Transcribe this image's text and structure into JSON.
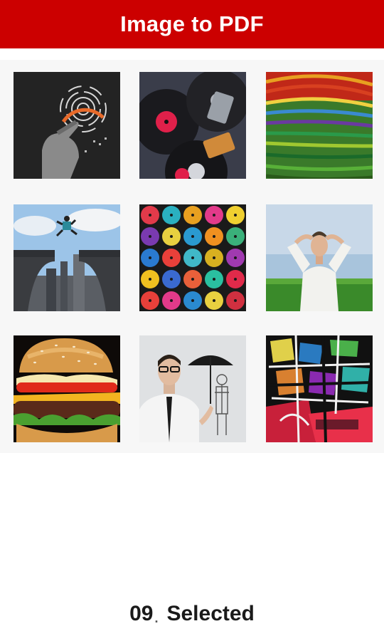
{
  "header": {
    "title": "Image to PDF"
  },
  "colors": {
    "header_bg": "#cc0000",
    "header_text": "#ffffff"
  },
  "grid": {
    "items": [
      {
        "name": "thumb-touch-interface"
      },
      {
        "name": "thumb-vinyl-records-cassettes"
      },
      {
        "name": "thumb-colorful-paint-strokes"
      },
      {
        "name": "thumb-man-jumping-bridge-gap"
      },
      {
        "name": "thumb-colorful-vinyl-discs"
      },
      {
        "name": "thumb-man-relaxing-field"
      },
      {
        "name": "thumb-hamburger"
      },
      {
        "name": "thumb-businessman-umbrella"
      },
      {
        "name": "thumb-abstract-graffiti"
      }
    ]
  },
  "footer": {
    "count": "09",
    "separator": ".",
    "label": "Selected"
  }
}
